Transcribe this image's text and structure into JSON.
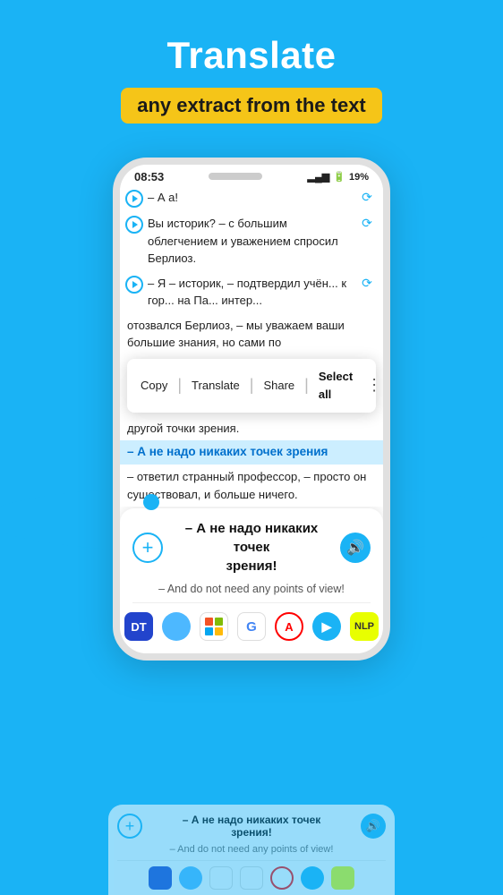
{
  "header": {
    "title": "Translate",
    "subtitle": "any extract from the text"
  },
  "phone": {
    "status_time": "08:53",
    "status_battery": "19%",
    "reader_rows": [
      {
        "text": "– А а!"
      },
      {
        "text": "Вы историк? – с большим облегчением и уважением спросил Берлиоз."
      },
      {
        "text": "– Я – историк, – подтвердил учён... к горо... на Па... интер..."
      }
    ],
    "overlay_text": "отозвался Берлиоз, – мы уважаем ваши большие знания, но сами по",
    "highlighted_text": "– А не надо никаких точек зрения",
    "after_highlight": "– ответил странный профессор, – просто он существовал, и больше ничего.",
    "context_menu": {
      "items": [
        "Copy",
        "Translate",
        "Share",
        "Select all"
      ],
      "more": "⋮"
    }
  },
  "translation_panel": {
    "source_text": "– А не надо никаких точек зрения!",
    "translated_text": "– And do not need any points of view!",
    "add_label": "+",
    "speaker_icon": "🔊"
  },
  "app_icons": [
    {
      "name": "DT",
      "type": "dt"
    },
    {
      "name": "bubble",
      "type": "bubble"
    },
    {
      "name": "MS",
      "type": "ms"
    },
    {
      "name": "G",
      "type": "google"
    },
    {
      "name": "A",
      "type": "a"
    },
    {
      "name": "arrow",
      "type": "arrow"
    },
    {
      "name": "NLP",
      "type": "nlp"
    }
  ],
  "bg_panel": {
    "source_text": "– А не надо никаких точек зрения!",
    "translated_text": "– And do not need any points of view!"
  }
}
